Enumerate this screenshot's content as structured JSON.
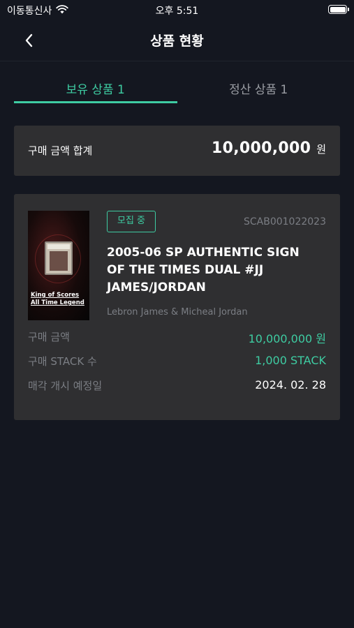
{
  "status_bar": {
    "carrier": "이동통신사",
    "time": "오후 5:51",
    "wifi_icon": "wifi-icon",
    "battery_icon": "battery-icon"
  },
  "nav": {
    "back_icon": "chevron-left-icon",
    "title": "상품 현황"
  },
  "tabs": [
    {
      "label": "보유 상품 1",
      "active": true
    },
    {
      "label": "정산 상품 1",
      "active": false
    }
  ],
  "summary": {
    "label": "구매 금액 합계",
    "amount": "10,000,000",
    "unit": "원"
  },
  "product": {
    "badge": "모집 중",
    "code": "SCAB001022023",
    "title": "2005-06 SP AUTHENTIC SIGN OF THE TIMES DUAL #JJ JAMES/JORDAN",
    "players": "Lebron James & Micheal Jordan",
    "image_caption_line1": "King of Scores",
    "image_caption_line2": "All Time Legend",
    "rows": [
      {
        "label": "구매 금액",
        "value": "10,000,000 원"
      },
      {
        "label": "구매 STACK 수",
        "value": "1,000 STACK"
      },
      {
        "label": "매각 개시 예정일",
        "value": "2024. 02. 28"
      }
    ]
  },
  "colors": {
    "background": "#141720",
    "card": "#2f2f31",
    "accent": "#3ecca2",
    "muted": "#7b7e84"
  }
}
